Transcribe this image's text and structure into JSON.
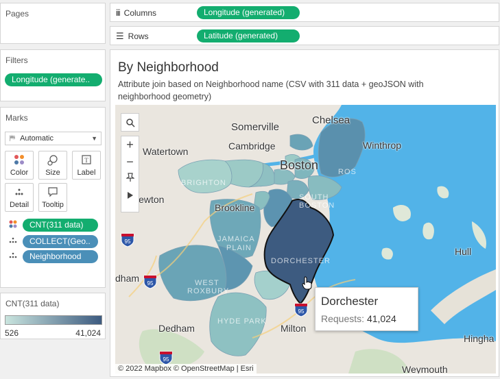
{
  "pages": {
    "title": "Pages"
  },
  "columns": {
    "label": "Columns",
    "pill": "Longitude (generated)"
  },
  "rows": {
    "label": "Rows",
    "pill": "Latitude (generated)"
  },
  "filters": {
    "title": "Filters",
    "pill": "Longitude (generate.."
  },
  "marks": {
    "title": "Marks",
    "type": "Automatic",
    "buttons": {
      "color": "Color",
      "size": "Size",
      "label": "Label",
      "detail": "Detail",
      "tooltip": "Tooltip"
    },
    "fields": {
      "color": "CNT(311 data)",
      "detail": "COLLECT(Geo..",
      "neighborhood": "Neighborhood"
    }
  },
  "legend": {
    "title": "CNT(311 data)",
    "min": "526",
    "max": "41,024",
    "color_low": "#c9e4de",
    "color_high": "#3d5b80"
  },
  "viz": {
    "title": "By Neighborhood",
    "subtitle": "Attribute join based on Neighborhood name (CSV with 311 data + geoJSON with neighborhood geometry)",
    "attribution": "© 2022 Mapbox © OpenStreetMap | Esri"
  },
  "map": {
    "places": {
      "somerville": "Somerville",
      "chelsea": "Chelsea",
      "watertown": "Watertown",
      "cambridge": "Cambridge",
      "winthrop": "Winthrop",
      "boston": "Boston",
      "newton": "Newton",
      "brookline": "Brookline",
      "hull": "Hull",
      "dedham_w": "dham",
      "milton": "Milton",
      "dedham": "Dedham",
      "hingham": "Hingha",
      "weymouth": "Weymouth",
      "brighton": "BRIGHTON",
      "jamaica": "JAMAICA",
      "plain": "PLAIN",
      "dorchester_faint": "DORCHESTER",
      "west": "WEST",
      "roxbury": "ROXBURY",
      "hyde_park": "HYDE PARK",
      "south": "SOUTH",
      "boston_small": "BOSTON",
      "ros": "ROS"
    },
    "highways": {
      "i95a": "95",
      "i95b": "95",
      "i95c": "95",
      "i95d": "95"
    }
  },
  "tooltip": {
    "title": "Dorchester",
    "label": "Requests:",
    "value": "41,024"
  }
}
